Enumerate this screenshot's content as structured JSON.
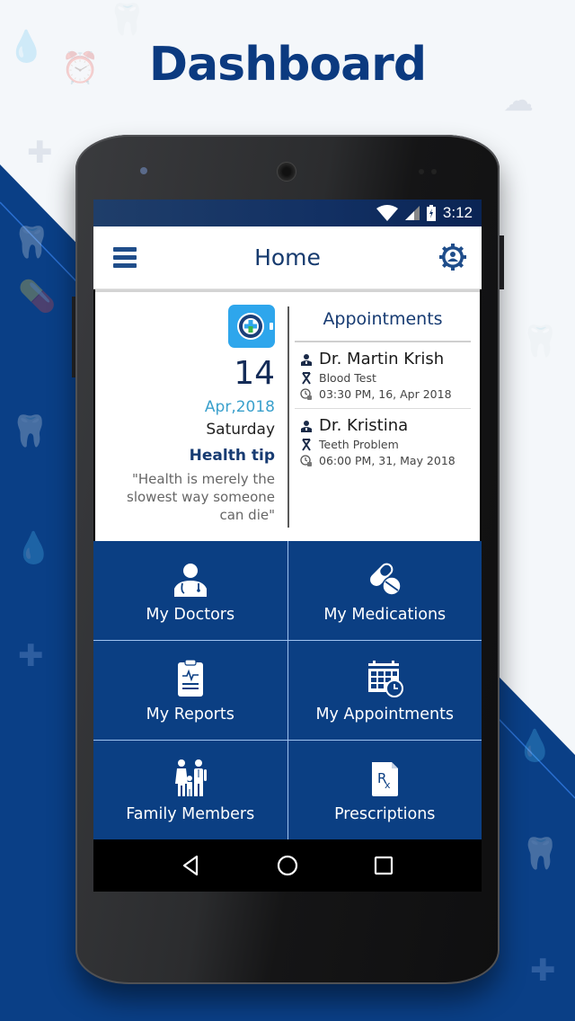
{
  "hero": {
    "title": "Dashboard"
  },
  "status_bar": {
    "time": "3:12",
    "icons": [
      "wifi-icon",
      "signal-icon",
      "battery-charging-icon"
    ]
  },
  "app_bar": {
    "title": "Home",
    "left_icon": "menu-icon",
    "right_icon": "profile-settings-icon"
  },
  "date_panel": {
    "logo": "app-logo-icon",
    "day": "14",
    "month_year": "Apr,2018",
    "weekday": "Saturday",
    "tip_title": "Health tip",
    "tip_text": "\"Health is merely the slowest way someone can die\""
  },
  "appointments": {
    "title": "Appointments",
    "items": [
      {
        "doctor": "Dr. Martin Krish",
        "reason": "Blood Test",
        "datetime": "03:30 PM, 16, Apr 2018"
      },
      {
        "doctor": "Dr. Kristina",
        "reason": "Teeth Problem",
        "datetime": "06:00 PM, 31, May 2018"
      }
    ]
  },
  "tiles": [
    {
      "label": "My Doctors",
      "icon": "doctor-icon"
    },
    {
      "label": "My Medications",
      "icon": "pills-icon"
    },
    {
      "label": "My Reports",
      "icon": "clipboard-report-icon"
    },
    {
      "label": "My Appointments",
      "icon": "calendar-clock-icon"
    },
    {
      "label": "Family Members",
      "icon": "family-icon"
    },
    {
      "label": "Prescriptions",
      "icon": "prescription-icon"
    }
  ],
  "nav": {
    "back": "back-icon",
    "home": "home-icon",
    "recents": "recents-icon"
  },
  "colors": {
    "brand_blue": "#0b3f83",
    "title_blue": "#0b3a80",
    "accent_cyan": "#3aa0cc",
    "tile_divider": "#9fc2ef"
  }
}
